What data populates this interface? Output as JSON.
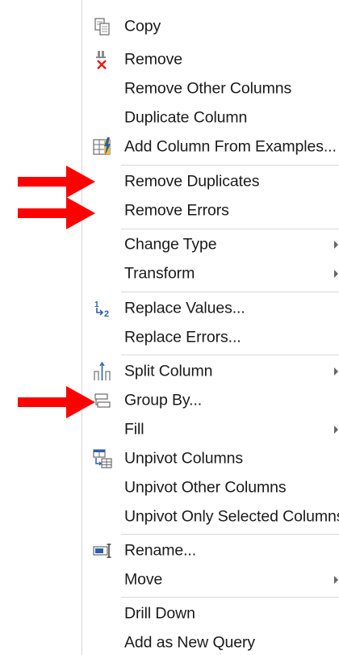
{
  "menu": {
    "items": [
      {
        "label": "Copy",
        "icon": "copy-icon"
      },
      {
        "label": "Remove",
        "icon": "remove-icon"
      },
      {
        "label": "Remove Other Columns"
      },
      {
        "label": "Duplicate Column"
      },
      {
        "label": "Add Column From Examples...",
        "icon": "add-column-from-examples-icon"
      },
      {
        "label": "Remove Duplicates"
      },
      {
        "label": "Remove Errors"
      },
      {
        "label": "Change Type",
        "submenu": true
      },
      {
        "label": "Transform",
        "submenu": true
      },
      {
        "label": "Replace Values...",
        "icon": "replace-values-icon"
      },
      {
        "label": "Replace Errors..."
      },
      {
        "label": "Split Column",
        "icon": "split-column-icon",
        "submenu": true
      },
      {
        "label": "Group By...",
        "icon": "group-by-icon"
      },
      {
        "label": "Fill",
        "submenu": true
      },
      {
        "label": "Unpivot Columns",
        "icon": "unpivot-columns-icon"
      },
      {
        "label": "Unpivot Other Columns"
      },
      {
        "label": "Unpivot Only Selected Columns"
      },
      {
        "label": "Rename...",
        "icon": "rename-icon"
      },
      {
        "label": "Move",
        "submenu": true
      },
      {
        "label": "Drill Down"
      },
      {
        "label": "Add as New Query"
      }
    ]
  },
  "annotations": {
    "arrow_color": "#ff0000",
    "arrows_point_to": [
      "Remove Duplicates",
      "Remove Errors",
      "Group By..."
    ]
  },
  "colors": {
    "menu_background": "#ffffff",
    "separator": "#d9d9d9",
    "text": "#1a1a1a"
  }
}
